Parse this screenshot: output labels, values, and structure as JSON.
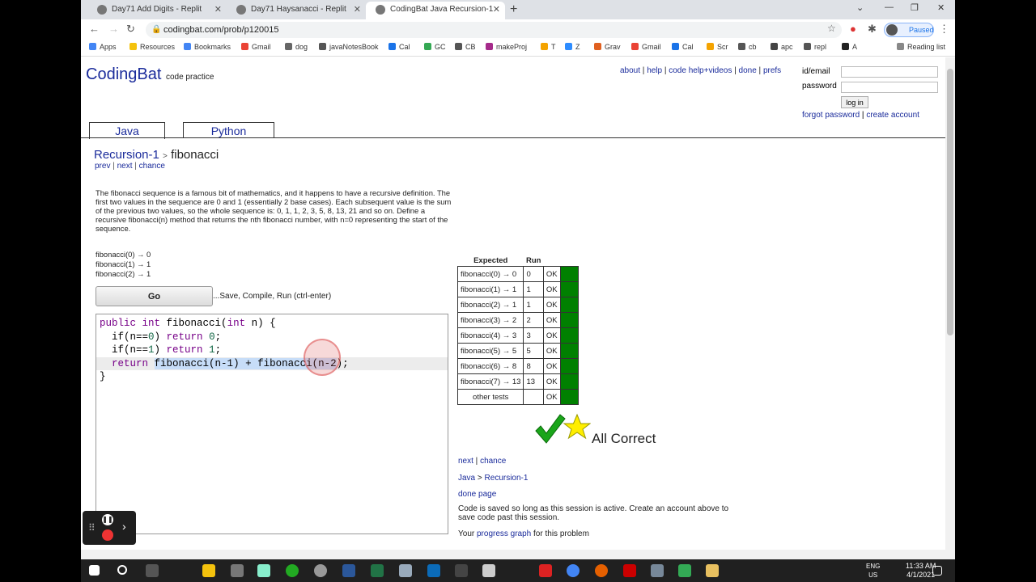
{
  "browser": {
    "tabs": [
      {
        "title": "Day71 Add Digits - Replit"
      },
      {
        "title": "Day71 Haysanacci - Replit"
      },
      {
        "title": "CodingBat Java Recursion-1 fibo"
      }
    ],
    "url": "codingbat.com/prob/p120015",
    "profile_status": "Paused",
    "bookmarks": [
      "Apps",
      "Resources",
      "Bookmarks",
      "Gmail",
      "dog",
      "javaNotesBook",
      "Cal",
      "GC",
      "CB",
      "makeProj",
      "T",
      "Z",
      "Grav",
      "Gmail",
      "Cal",
      "Scr",
      "cb",
      "apc",
      "repl",
      "A"
    ],
    "reading_list": "Reading list"
  },
  "site": {
    "brand": "CodingBat",
    "tagline": "code practice",
    "toplinks": [
      "about",
      "help",
      "code help+videos",
      "done",
      "prefs"
    ],
    "login": {
      "id_label": "id/email",
      "password_label": "password",
      "button": "log in",
      "forgot": "forgot password",
      "create": "create account"
    },
    "langs": [
      "Java",
      "Python"
    ]
  },
  "problem": {
    "category": "Recursion-1",
    "name": "fibonacci",
    "nav": [
      "prev",
      "next",
      "chance"
    ],
    "description": "The fibonacci sequence is a famous bit of mathematics, and it happens to have a recursive definition. The first two values in the sequence are 0 and 1 (essentially 2 base cases). Each subsequent value is the sum of the previous two values, so the whole sequence is: 0, 1, 1, 2, 3, 5, 8, 13, 21 and so on. Define a recursive fibonacci(n) method that returns the nth fibonacci number, with n=0 representing the start of the sequence.",
    "examples": [
      "fibonacci(0) → 0",
      "fibonacci(1) → 1",
      "fibonacci(2) → 1"
    ],
    "go_label": "Go",
    "go_hint": "...Save, Compile, Run (ctrl-enter)"
  },
  "code": {
    "l1_kw1": "public",
    "l1_kw2": "int",
    "l1_name": " fibonacci(",
    "l1_kw3": "int",
    "l1_end": " n) {",
    "l2_pre": "  if(n==",
    "l2_num": "0",
    "l2_mid": ") ",
    "l2_kw": "return",
    "l2_num2": " 0",
    "l2_end": ";",
    "l3_pre": "  if(n==",
    "l3_num": "1",
    "l3_mid": ") ",
    "l3_kw": "return",
    "l3_num2": " 1",
    "l3_end": ";",
    "l4_pre": "  ",
    "l4_kw": "return",
    "l4_sel": "fibonacci(n-1) + fibonacci(n-2",
    "l4_end": ");",
    "l5": "}"
  },
  "results": {
    "headers": [
      "Expected",
      "Run"
    ],
    "rows": [
      {
        "expected": "fibonacci(0) → 0",
        "run": "0",
        "status": "OK"
      },
      {
        "expected": "fibonacci(1) → 1",
        "run": "1",
        "status": "OK"
      },
      {
        "expected": "fibonacci(2) → 1",
        "run": "1",
        "status": "OK"
      },
      {
        "expected": "fibonacci(3) → 2",
        "run": "2",
        "status": "OK"
      },
      {
        "expected": "fibonacci(4) → 3",
        "run": "3",
        "status": "OK"
      },
      {
        "expected": "fibonacci(5) → 5",
        "run": "5",
        "status": "OK"
      },
      {
        "expected": "fibonacci(6) → 8",
        "run": "8",
        "status": "OK"
      },
      {
        "expected": "fibonacci(7) → 13",
        "run": "13",
        "status": "OK"
      },
      {
        "expected": "other tests",
        "run": "",
        "status": "OK"
      }
    ],
    "verdict": "All Correct",
    "pass_color": "#008000"
  },
  "after": {
    "next": "next",
    "chance": "chance",
    "crumb_lang": "Java",
    "crumb_sep": ">",
    "crumb_cat": "Recursion-1",
    "done_page": "done page",
    "save_note": "Code is saved so long as this session is active. Create an account above to save code past this session.",
    "progress_pre": "Your ",
    "progress_link": "progress graph",
    "progress_post": " for this problem"
  },
  "taskbar": {
    "lang_top": "ENG",
    "lang_bottom": "US",
    "time": "11:33 AM",
    "date": "4/1/2021"
  }
}
